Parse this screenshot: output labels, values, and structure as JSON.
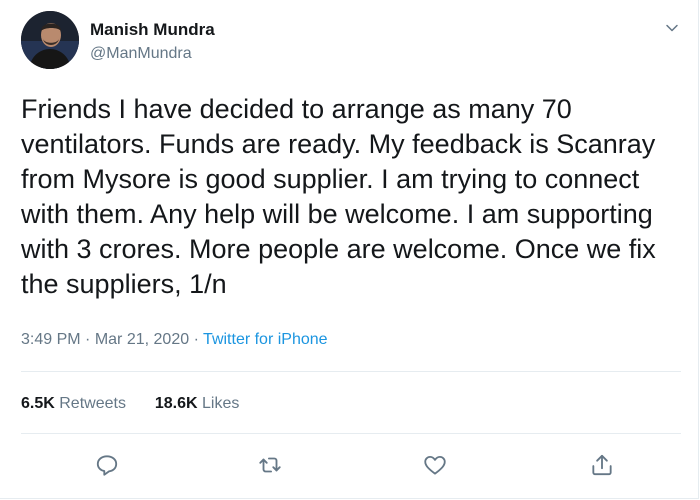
{
  "tweet": {
    "author": {
      "display_name": "Manish Mundra",
      "handle": "@ManMundra",
      "avatar_icon": "profile-photo"
    },
    "text_lines": [
      "Friends I have decided to arrange as many 70",
      "ventilators. Funds are ready. My feedback is Scanray",
      "from Mysore is good supplier. I am trying to connect",
      "with them. Any help will be welcome. I am supporting",
      "with 3 crores. More people are welcome. Once we fix",
      "the suppliers, 1/n"
    ],
    "time": "3:49 PM",
    "date": "Mar 21, 2020",
    "separator": "·",
    "source": "Twitter for iPhone",
    "stats": {
      "retweets_count": "6.5K",
      "retweets_label": "Retweets",
      "likes_count": "18.6K",
      "likes_label": "Likes"
    },
    "actions": [
      "reply-icon",
      "retweet-icon",
      "like-icon",
      "share-icon"
    ]
  },
  "colors": {
    "text": "#14171a",
    "muted": "#657786",
    "link": "#1b95e0",
    "divider": "#e6ecf0"
  }
}
